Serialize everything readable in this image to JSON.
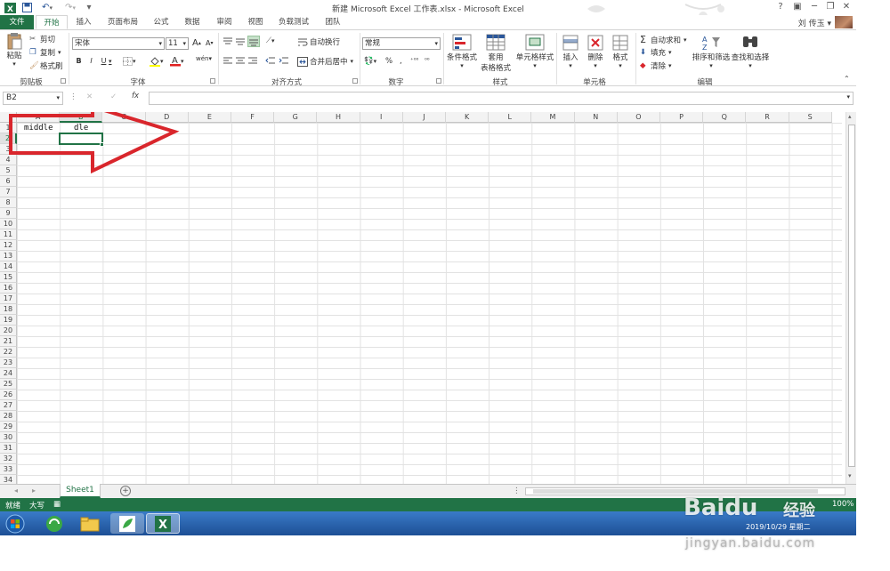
{
  "window": {
    "title": "新建 Microsoft Excel 工作表.xlsx - Microsoft Excel",
    "help": "?",
    "minimize": "─",
    "restore": "❐",
    "close": "✕"
  },
  "quick_access": {
    "save_icon": "save-icon",
    "undo_icon": "undo-icon",
    "redo_icon": "redo-icon"
  },
  "tabs": [
    {
      "label": "文件"
    },
    {
      "label": "开始"
    },
    {
      "label": "插入"
    },
    {
      "label": "页面布局"
    },
    {
      "label": "公式"
    },
    {
      "label": "数据"
    },
    {
      "label": "审阅"
    },
    {
      "label": "视图"
    },
    {
      "label": "负载测试"
    },
    {
      "label": "团队"
    }
  ],
  "user": {
    "name": "刘 传玉 ▾"
  },
  "ribbon": {
    "clipboard": {
      "paste": "粘贴",
      "cut": "剪切",
      "copy": "复制",
      "format_painter": "格式刷",
      "label": "剪贴板"
    },
    "font": {
      "name": "宋体",
      "size": "11",
      "grow": "A",
      "shrink": "A",
      "bold": "B",
      "italic": "I",
      "underline": "U",
      "label": "字体"
    },
    "alignment": {
      "wrap": "自动换行",
      "merge": "合并后居中",
      "label": "对齐方式"
    },
    "number": {
      "format": "常规",
      "label": "数字"
    },
    "styles": {
      "conditional": "条件格式",
      "table1": "套用",
      "table2": "表格格式",
      "cell": "单元格样式",
      "label": "样式"
    },
    "cells": {
      "insert": "插入",
      "delete": "删除",
      "format": "格式",
      "label": "单元格"
    },
    "editing": {
      "autosum": "自动求和",
      "fill": "填充",
      "clear": "清除",
      "sort": "排序和筛选",
      "find": "查找和选择",
      "label": "编辑"
    }
  },
  "formula_bar": {
    "name_box": "B2",
    "fx": "fx",
    "value": ""
  },
  "grid": {
    "columns": [
      "A",
      "B",
      "C",
      "D",
      "E",
      "F",
      "G",
      "H",
      "I",
      "J",
      "K",
      "L",
      "M",
      "N",
      "O",
      "P",
      "Q",
      "R",
      "S"
    ],
    "selected_column": "B",
    "rows": [
      "1",
      "2",
      "3",
      "4",
      "5",
      "6",
      "7",
      "8",
      "9",
      "10",
      "11",
      "12",
      "13",
      "14",
      "15",
      "16",
      "17",
      "18",
      "19",
      "20",
      "21",
      "22",
      "23",
      "24",
      "25",
      "26",
      "27",
      "28",
      "29",
      "30",
      "31",
      "32",
      "33",
      "34"
    ],
    "selected_row": "2",
    "cells": {
      "A1": "middle",
      "B1": "dle"
    },
    "active_cell": "B2"
  },
  "sheets": [
    {
      "name": "Sheet1",
      "active": true
    }
  ],
  "status": {
    "ready": "就绪",
    "caps": "大写",
    "zoom": "100%"
  },
  "taskbar": {
    "clock_date": "2019/10/29 星期二"
  },
  "watermark": {
    "brand": "Baidu",
    "site": "jingyan.baidu.com",
    "cn": "经验"
  },
  "colors": {
    "excel_green": "#217346",
    "arrow_red": "#d9262c"
  }
}
